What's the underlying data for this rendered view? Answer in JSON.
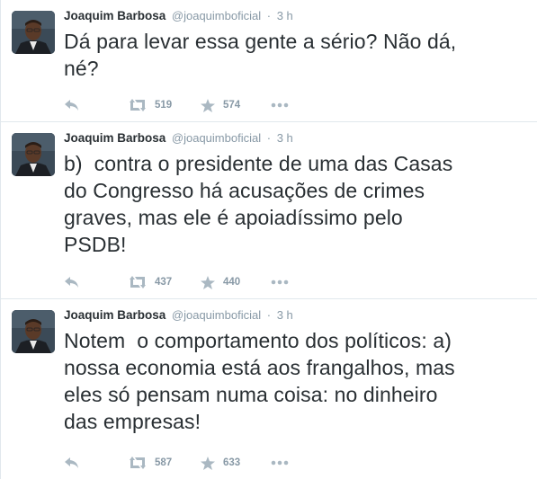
{
  "tweets": [
    {
      "fullname": "Joaquim Barbosa",
      "username": "@joaquimboficial",
      "separator": "·",
      "time": "3 h",
      "text": "Dá para levar essa gente a sério? Não dá,\nné?",
      "retweets": "519",
      "favorites": "574"
    },
    {
      "fullname": "Joaquim Barbosa",
      "username": "@joaquimboficial",
      "separator": "·",
      "time": "3 h",
      "text": "b)  contra o presidente de uma das Casas\ndo Congresso há acusações de crimes\ngraves, mas ele é apoiadíssimo pelo\nPSDB!",
      "retweets": "437",
      "favorites": "440"
    },
    {
      "fullname": "Joaquim Barbosa",
      "username": "@joaquimboficial",
      "separator": "·",
      "time": "3 h",
      "text": "Notem  o comportamento dos políticos: a)\nnossa economia está aos frangalhos, mas\neles só pensam numa coisa: no dinheiro\ndas empresas!",
      "retweets": "587",
      "favorites": "633"
    }
  ],
  "icons": {
    "reply": "reply-icon",
    "retweet": "retweet-icon",
    "favorite": "star-icon",
    "more": "more-icon"
  },
  "colors": {
    "text": "#292f33",
    "muted": "#8899a6",
    "icon": "#aab8c2",
    "border": "#e1e8ed"
  }
}
